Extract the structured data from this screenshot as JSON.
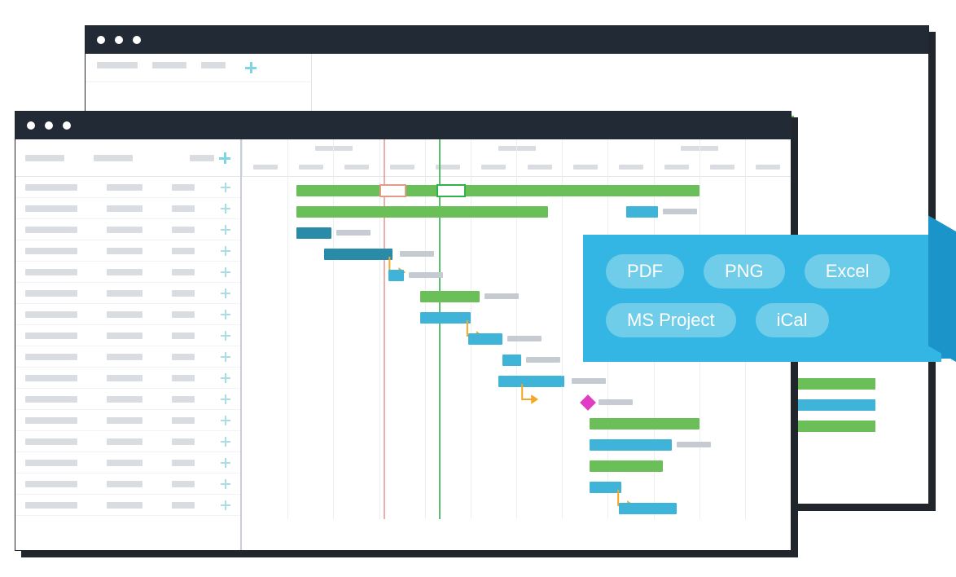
{
  "export_options": [
    "PDF",
    "PNG",
    "Excel",
    "MS Project",
    "iCal"
  ],
  "gantt": {
    "timeline_cols": 12,
    "red_marker_col": 3.1,
    "green_marker_col": 4.3,
    "rows": [
      {
        "bars": [
          {
            "start": 1.2,
            "end": 10.0,
            "cls": "green"
          }
        ],
        "red_box": {
          "start": 3.0,
          "end": 3.6
        },
        "green_box": {
          "start": 4.25,
          "end": 4.9
        }
      },
      {
        "bars": [
          {
            "start": 1.2,
            "end": 6.7,
            "cls": "green"
          },
          {
            "start": 8.4,
            "end": 9.1,
            "cls": "blue",
            "label_after": true
          }
        ]
      },
      {
        "bars": [
          {
            "start": 1.2,
            "end": 1.95,
            "cls": "dblue",
            "label_after": true
          }
        ]
      },
      {
        "bars": [
          {
            "start": 1.8,
            "end": 3.3,
            "cls": "dblue"
          }
        ],
        "dep_to_next": {
          "from": 3.3
        },
        "label_after_x": 3.35
      },
      {
        "bars": [
          {
            "start": 3.2,
            "end": 3.55,
            "cls": "blue",
            "label_after": true
          }
        ]
      },
      {
        "bars": [
          {
            "start": 3.9,
            "end": 5.2,
            "cls": "green",
            "label_after": true
          }
        ]
      },
      {
        "bars": [
          {
            "start": 3.9,
            "end": 5.0,
            "cls": "blue"
          }
        ],
        "dep_to_next": {
          "from": 5.0
        }
      },
      {
        "bars": [
          {
            "start": 4.95,
            "end": 5.7,
            "cls": "blue",
            "label_after": true
          }
        ]
      },
      {
        "bars": [
          {
            "start": 5.7,
            "end": 6.1,
            "cls": "blue",
            "label_after": true
          }
        ],
        "dep_target": true
      },
      {
        "bars": [
          {
            "start": 5.6,
            "end": 7.0,
            "cls": "blue"
          },
          {
            "start": 7.0,
            "end": 7.05,
            "cls": "blue"
          }
        ],
        "dep_to_next": {
          "from": 6.2
        },
        "label_after_x": 7.1
      },
      {
        "milestone_x": 7.45,
        "label_after_x": 7.7
      },
      {
        "bars": [
          {
            "start": 7.6,
            "end": 10.0,
            "cls": "green"
          }
        ]
      },
      {
        "bars": [
          {
            "start": 7.6,
            "end": 9.4,
            "cls": "blue",
            "label_after": true
          }
        ]
      },
      {
        "bars": [
          {
            "start": 7.6,
            "end": 9.2,
            "cls": "green"
          }
        ]
      },
      {
        "bars": [
          {
            "start": 7.6,
            "end": 8.3,
            "cls": "blue"
          }
        ],
        "dep_to_next": {
          "from": 8.3
        }
      },
      {
        "bars": [
          {
            "start": 8.25,
            "end": 9.5,
            "cls": "blue"
          }
        ]
      }
    ]
  },
  "task_rows_count": 16,
  "colors": {
    "titlebar": "#222a35",
    "green": "#6bbf59",
    "blue": "#3fb4d8",
    "accent_teal": "#7fd6e3",
    "milestone": "#e13cc4",
    "dependency": "#f5a623",
    "popover": "#34b6e4"
  }
}
